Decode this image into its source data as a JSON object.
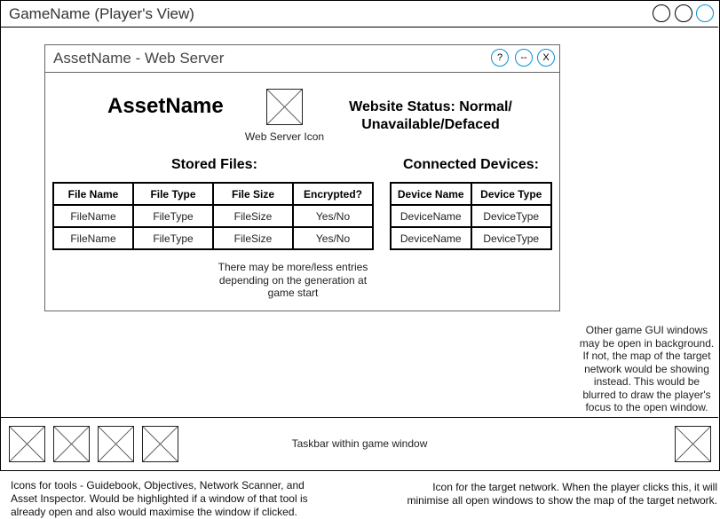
{
  "app": {
    "title": "GameName (Player's View)"
  },
  "window": {
    "title": "AssetName - Web Server",
    "buttons": {
      "help": "?",
      "minimise": "--",
      "close": "X"
    },
    "asset_name": "AssetName",
    "icon_caption": "Web Server Icon",
    "status_line1": "Website Status: Normal/",
    "status_line2": "Unavailable/Defaced",
    "stored_files": {
      "heading": "Stored Files:",
      "columns": [
        "File Name",
        "File Type",
        "File Size",
        "Encrypted?"
      ],
      "rows": [
        [
          "FileName",
          "FileType",
          "FileSize",
          "Yes/No"
        ],
        [
          "FileName",
          "FileType",
          "FileSize",
          "Yes/No"
        ]
      ]
    },
    "connected_devices": {
      "heading": "Connected Devices:",
      "columns": [
        "Device Name",
        "Device Type"
      ],
      "rows": [
        [
          "DeviceName",
          "DeviceType"
        ],
        [
          "DeviceName",
          "DeviceType"
        ]
      ]
    },
    "entries_note": [
      "There may be more/less entries",
      "depending on the generation at",
      "game start"
    ]
  },
  "background_note": [
    "Other game GUI windows",
    "may be open in background.",
    "If not, the map of the target",
    "network would be showing",
    "instead. This would be",
    "blurred to draw the player's",
    "focus to the open window."
  ],
  "taskbar": {
    "label": "Taskbar within game window"
  },
  "notes": {
    "tools": [
      "Icons for tools - Guidebook, Objectives, Network Scanner, and",
      "Asset Inspector. Would be highlighted if a window of that tool is",
      "already open and also would maximise the window if clicked."
    ],
    "network": [
      "Icon for the target network. When the player clicks this, it will",
      "minimise all open windows to show the map of the target network."
    ]
  },
  "colors": {
    "accent": "#0a8fd4"
  }
}
